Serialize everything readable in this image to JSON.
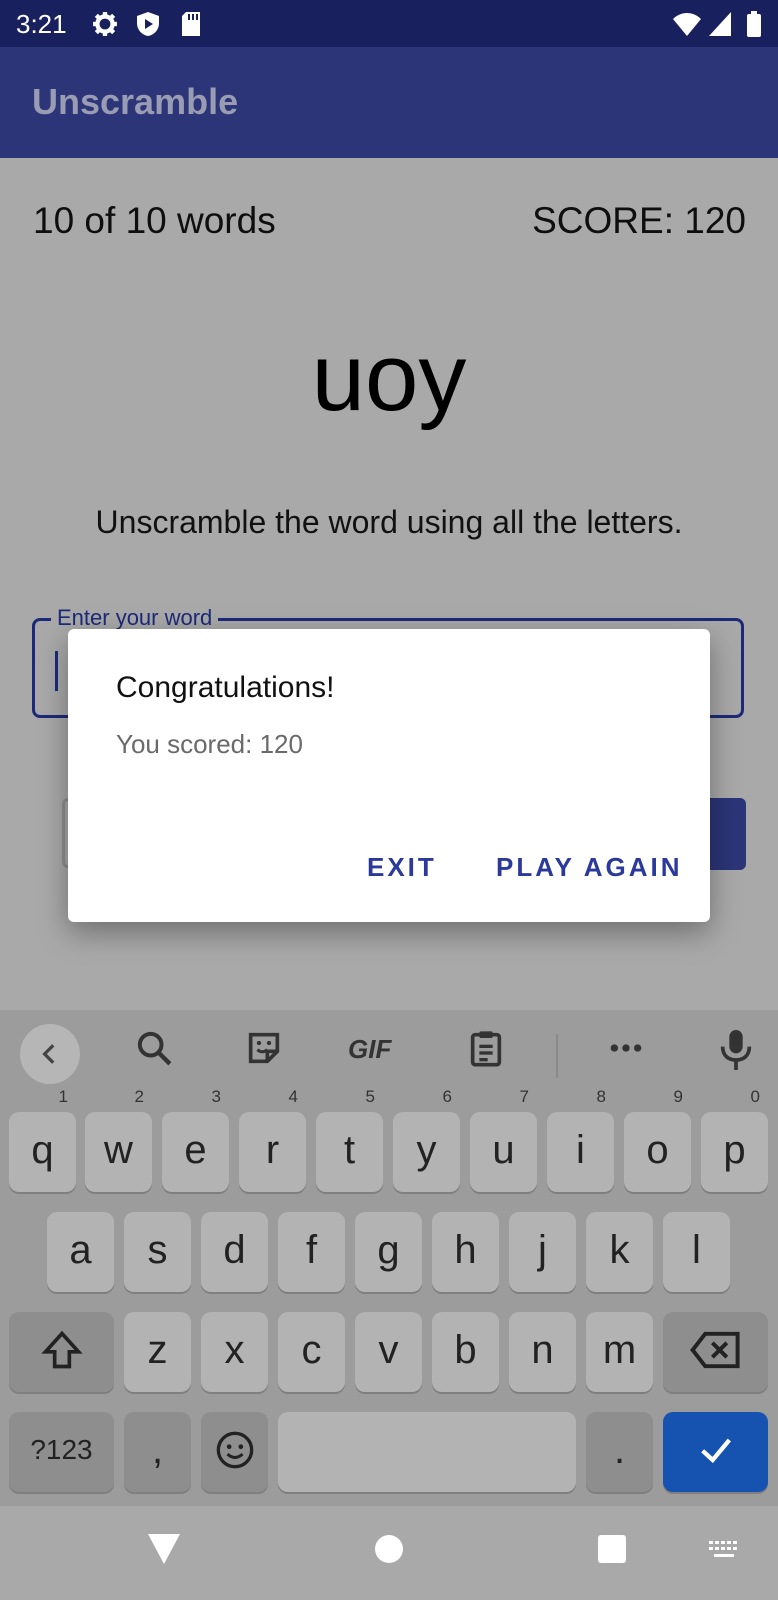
{
  "status_bar": {
    "time": "3:21",
    "icons_left": [
      "gear-icon",
      "shield-play-icon",
      "sd-card-icon"
    ],
    "icons_right": [
      "wifi-icon",
      "signal-icon",
      "battery-icon"
    ]
  },
  "app_bar": {
    "title": "Unscramble"
  },
  "game": {
    "word_count": "10 of 10 words",
    "score": "SCORE: 120",
    "scrambled_word": "uoy",
    "instructions": "Unscramble the word using all the letters.",
    "input_label": "Enter your word",
    "input_value": ""
  },
  "dialog": {
    "title": "Congratulations!",
    "message": "You scored: 120",
    "exit_label": "EXIT",
    "play_again_label": "PLAY AGAIN"
  },
  "keyboard": {
    "toolbar": [
      "back-icon",
      "search-icon",
      "sticker-icon",
      "gif-label",
      "clipboard-icon",
      "more-icon",
      "mic-icon"
    ],
    "gif_label": "GIF",
    "row1": [
      {
        "k": "q",
        "h": "1"
      },
      {
        "k": "w",
        "h": "2"
      },
      {
        "k": "e",
        "h": "3"
      },
      {
        "k": "r",
        "h": "4"
      },
      {
        "k": "t",
        "h": "5"
      },
      {
        "k": "y",
        "h": "6"
      },
      {
        "k": "u",
        "h": "7"
      },
      {
        "k": "i",
        "h": "8"
      },
      {
        "k": "o",
        "h": "9"
      },
      {
        "k": "p",
        "h": "0"
      }
    ],
    "row2": [
      "a",
      "s",
      "d",
      "f",
      "g",
      "h",
      "j",
      "k",
      "l"
    ],
    "row3": [
      "z",
      "x",
      "c",
      "v",
      "b",
      "n",
      "m"
    ],
    "symbols_label": "?123",
    "comma": ",",
    "period": "."
  },
  "colors": {
    "status_bar": "#18215e",
    "app_bar": "#2b3578",
    "accent": "#2b3a9a",
    "enter_key": "#1653b0"
  }
}
